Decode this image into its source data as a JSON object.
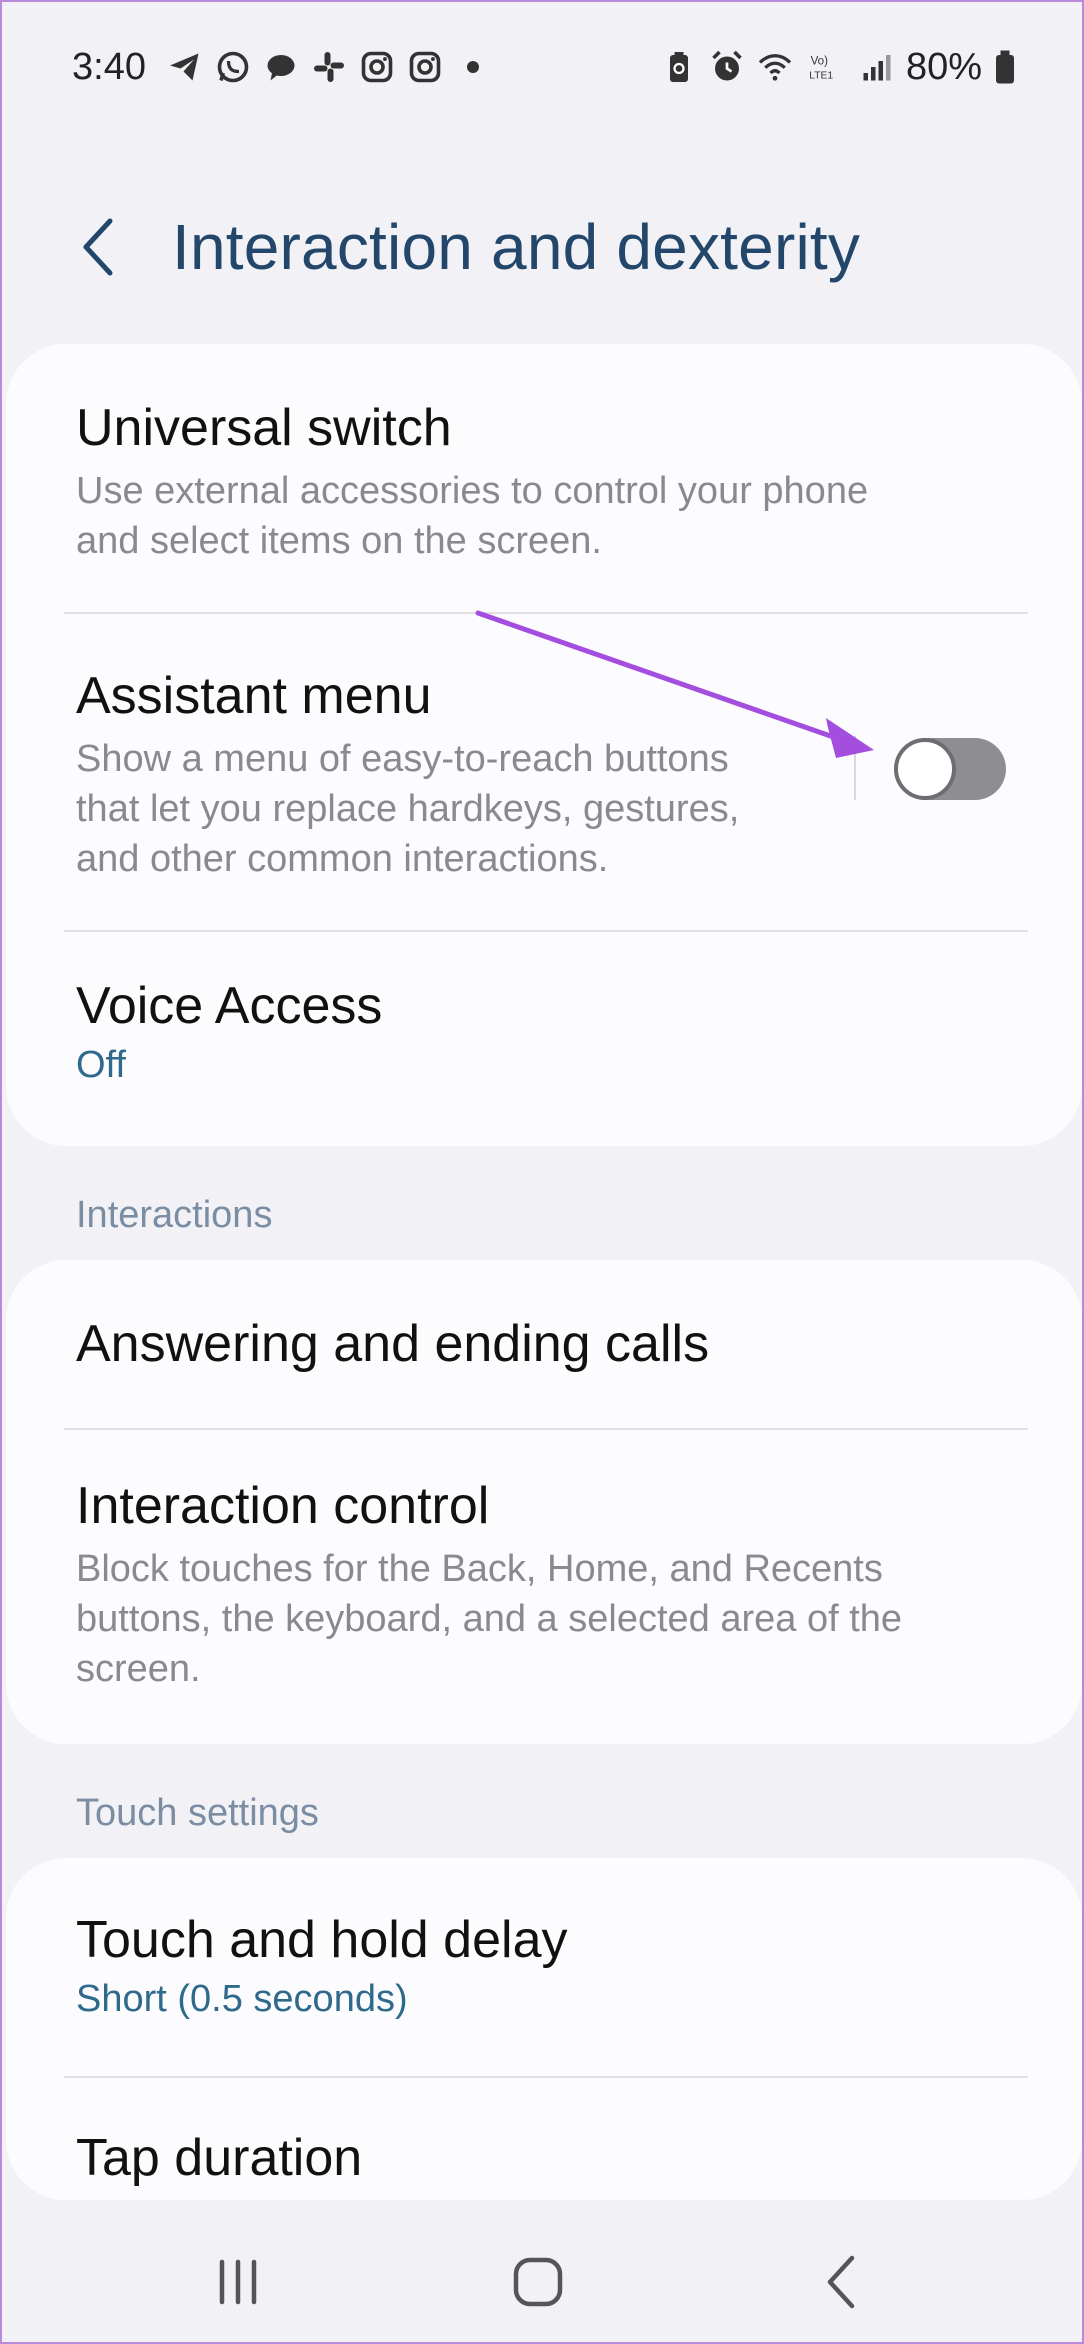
{
  "status_bar": {
    "time": "3:40",
    "battery": "80%",
    "left_icons": [
      "telegram-icon",
      "whatsapp-icon",
      "chat-icon",
      "slack-icon",
      "instagram-icon",
      "instagram-icon",
      "dot-icon"
    ],
    "right_icons": [
      "battery-saver-icon",
      "alarm-icon",
      "wifi-icon",
      "volte-icon",
      "signal-icon",
      "battery-icon"
    ]
  },
  "header": {
    "title": "Interaction and dexterity"
  },
  "card1": {
    "universal_switch": {
      "title": "Universal switch",
      "desc_line1": "Use external accessories to control your phone",
      "desc_line2": "and select items on the screen."
    },
    "assistant_menu": {
      "title": "Assistant menu",
      "desc_line1": "Show a menu of easy-to-reach buttons",
      "desc_line2": "that let you replace hardkeys, gestures,",
      "desc_line3": "and other common interactions.",
      "toggle_on": false
    },
    "voice_access": {
      "title": "Voice Access",
      "value": "Off"
    }
  },
  "sections": {
    "interactions": "Interactions",
    "touch_settings": "Touch settings"
  },
  "card2": {
    "answering": {
      "title": "Answering and ending calls"
    },
    "interaction_control": {
      "title": "Interaction control",
      "desc_line1": "Block touches for the Back, Home, and Recents",
      "desc_line2": "buttons, the keyboard, and a selected area of the",
      "desc_line3": "screen."
    }
  },
  "card3": {
    "touch_hold": {
      "title": "Touch and hold delay",
      "value": "Short (0.5 seconds)"
    },
    "tap_duration": {
      "title": "Tap duration"
    }
  },
  "colors": {
    "title": "#23466b",
    "value": "#2f6a8c",
    "annotation_arrow": "#a44ee0"
  }
}
